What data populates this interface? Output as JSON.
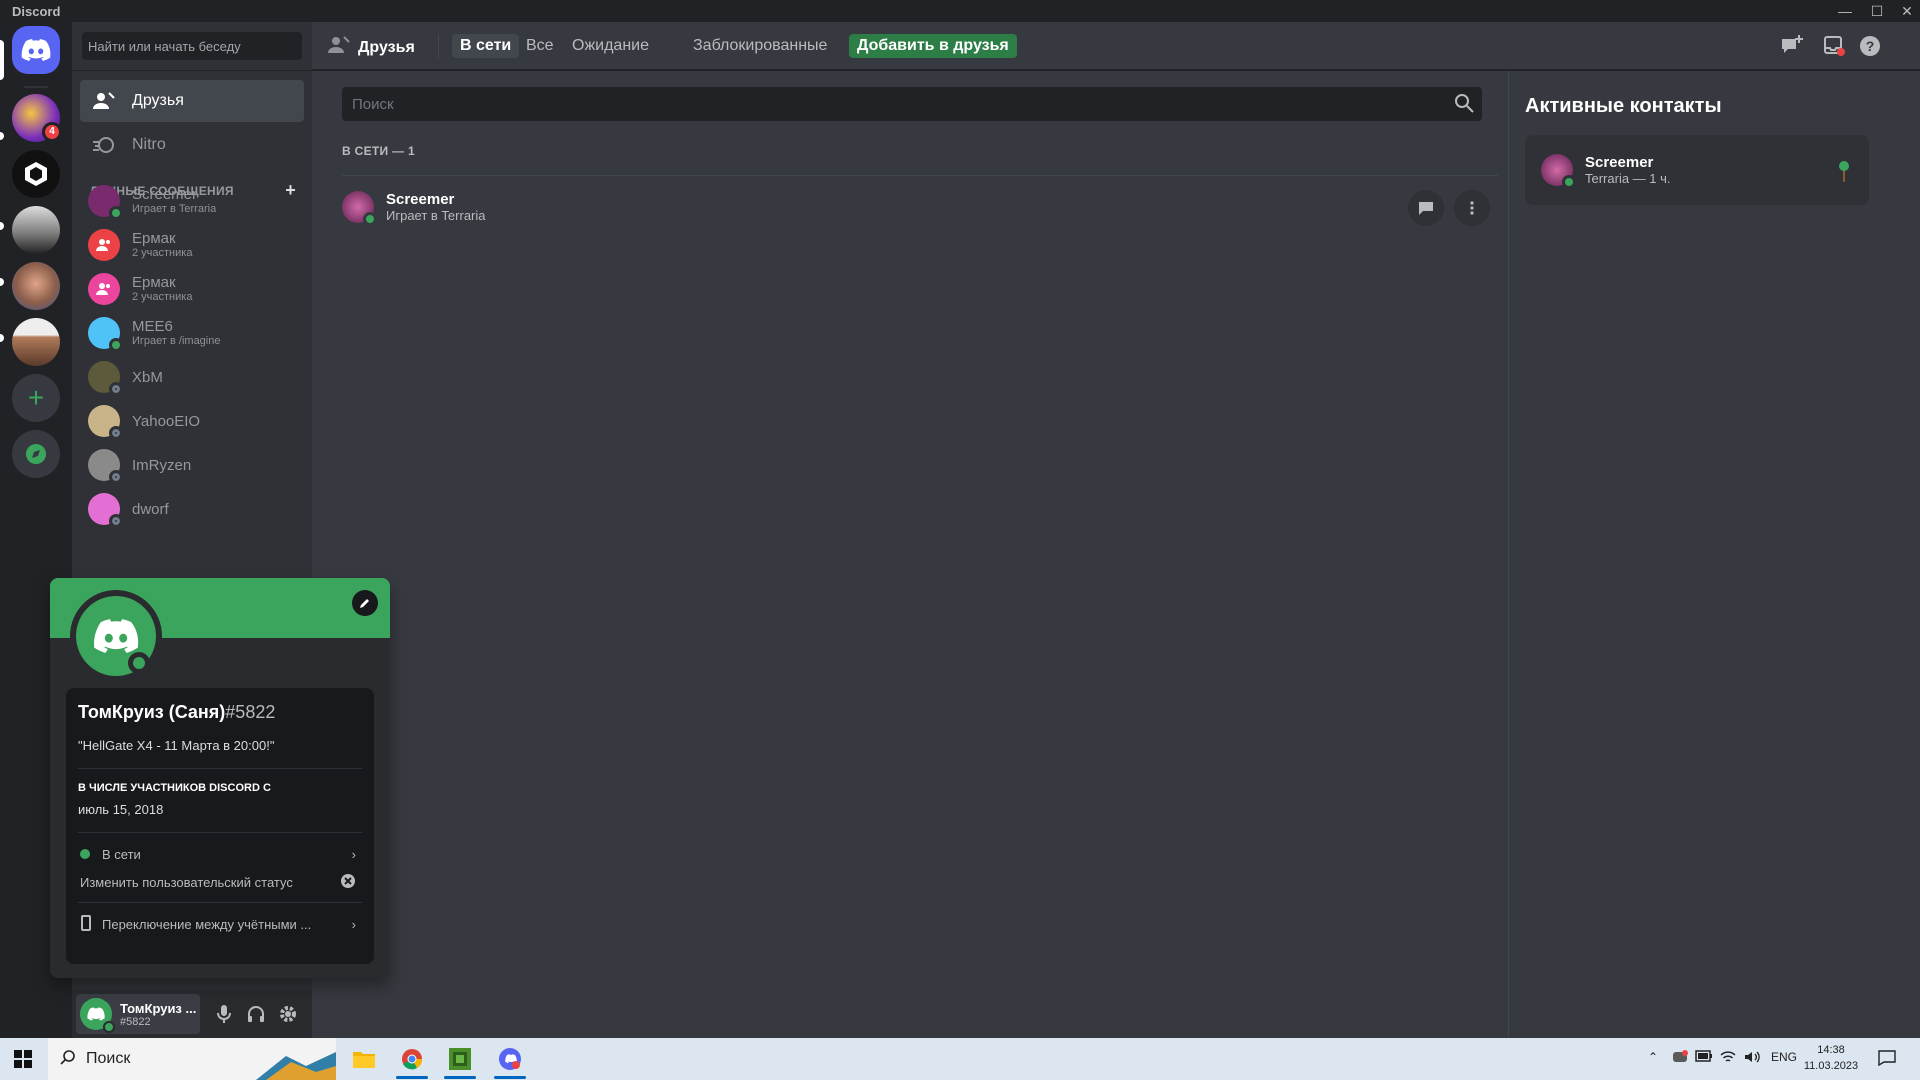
{
  "window": {
    "title": "Discord"
  },
  "servers": {
    "unread_badge": "4"
  },
  "sidebar": {
    "search_placeholder": "Найти или начать беседу",
    "nav": [
      {
        "label": "Друзья",
        "icon": "friends-icon"
      },
      {
        "label": "Nitro",
        "icon": "nitro-icon"
      }
    ],
    "dm_header": "ЛИЧНЫЕ СООБЩЕНИЯ",
    "dms": [
      {
        "name": "Screemer",
        "sub": "Играет в Terraria",
        "status": "online",
        "color": "#7a2b6e"
      },
      {
        "name": "Ермак",
        "sub": "2 участника",
        "status": "group",
        "color": "#ed4245"
      },
      {
        "name": "Ермак",
        "sub": "2 участника",
        "status": "group",
        "color": "#eb459e"
      },
      {
        "name": "MEE6",
        "sub": "Играет в /imagine",
        "status": "online",
        "color": "#4fc3f7"
      },
      {
        "name": "XbM",
        "sub": "",
        "status": "offline",
        "color": "#5d5a3c"
      },
      {
        "name": "YahooEIO",
        "sub": "",
        "status": "offline",
        "color": "#c9b48a"
      },
      {
        "name": "ImRyzen",
        "sub": "",
        "status": "offline",
        "color": "#8a8a8a"
      },
      {
        "name": "dworf",
        "sub": "",
        "status": "offline",
        "color": "#e46fd4"
      }
    ]
  },
  "user_panel": {
    "name": "ТомКруиз ...",
    "tag": "#5822"
  },
  "topbar": {
    "title": "Друзья",
    "tabs": [
      "В сети",
      "Все",
      "Ожидание",
      "Заблокированные"
    ],
    "add_friend": "Добавить в друзья"
  },
  "main": {
    "search_placeholder": "Поиск",
    "online_header": "В СЕТИ — 1",
    "friends": [
      {
        "name": "Screemer",
        "sub": "Играет в Terraria"
      }
    ]
  },
  "right_panel": {
    "title": "Активные контакты",
    "contacts": [
      {
        "name": "Screemer",
        "sub": "Terraria — 1 ч."
      }
    ]
  },
  "profile": {
    "name": "ТомКруиз (Саня)",
    "tag": "#5822",
    "bio": "\"HellGate X4 - 11 Марта в 20:00!\"",
    "since_header": "В ЧИСЛЕ УЧАСТНИКОВ DISCORD С",
    "since_date": "июль 15, 2018",
    "status_label": "В сети",
    "custom_status": "Изменить пользовательский статус",
    "switch_accounts": "Переключение между учётными ...",
    "banner_color": "#3ba55d"
  },
  "taskbar": {
    "search": "Поиск",
    "lang": "ENG",
    "time": "14:38",
    "date": "11.03.2023"
  }
}
